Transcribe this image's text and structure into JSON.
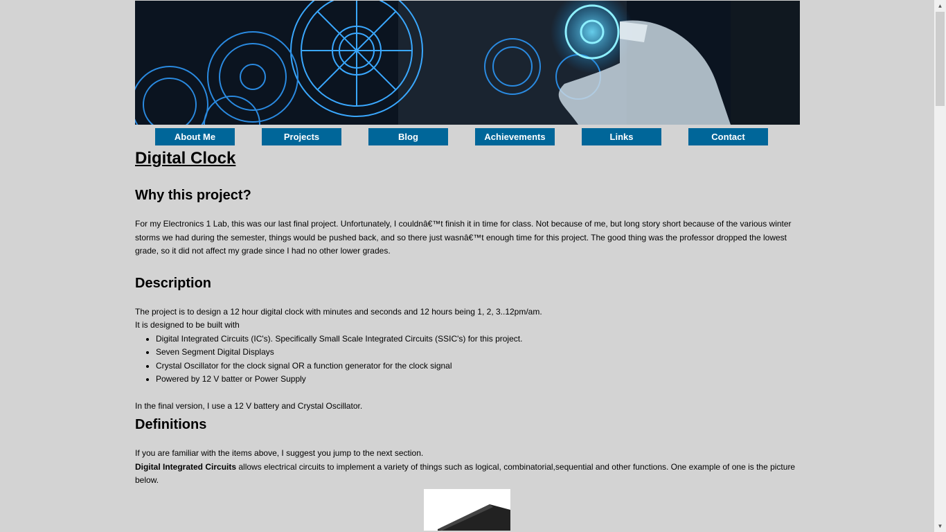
{
  "nav": {
    "items": [
      "About Me",
      "Projects",
      "Blog",
      "Achievements",
      "Links",
      "Contact"
    ]
  },
  "page": {
    "title": "Digital Clock",
    "why_heading": "Why this project?",
    "why_text": "For my Electronics 1 Lab, this was our last final project. Unfortunately, I couldnâ€™t finish it in time for class. Not because of me, but long story short because of the various winter storms we had during the semester, things would be pushed back, and so there just wasnâ€™t enough time for this project. The good thing was the professor dropped the lowest grade, so it did not affect my grade since I had no other lower grades.",
    "desc_heading": "Description",
    "desc_line1": "The project is to design a 12 hour digital clock with minutes and seconds and 12 hours being 1, 2, 3..12pm/am.",
    "desc_line2": "It is designed to be built with",
    "desc_items": [
      "Digital Integrated Circuits (IC's). Specifically Small Scale Integrated Circuits (SSIC's) for this project.",
      "Seven Segment Digital Displays",
      "Crystal Oscillator for the clock signal OR a function generator for the clock signal",
      "Powered by 12 V batter or Power Supply"
    ],
    "desc_final": "In the final version, I use a 12 V battery and Crystal Oscillator.",
    "defs_heading": "Definitions",
    "defs_line1": "If you are familiar with the items above, I suggest you jump to the next section.",
    "defs_term": "Digital Integrated Circuits",
    "defs_text": " allows electrical circuits to implement a variety of things such as logical, combinatorial,sequential and other functions. One example of one is the picture below."
  },
  "icons": {
    "scroll_up": "scroll-up-arrow-icon",
    "scroll_down": "scroll-down-arrow-icon"
  },
  "colors": {
    "nav_bg": "#006699",
    "page_bg": "#d3d3d3"
  }
}
